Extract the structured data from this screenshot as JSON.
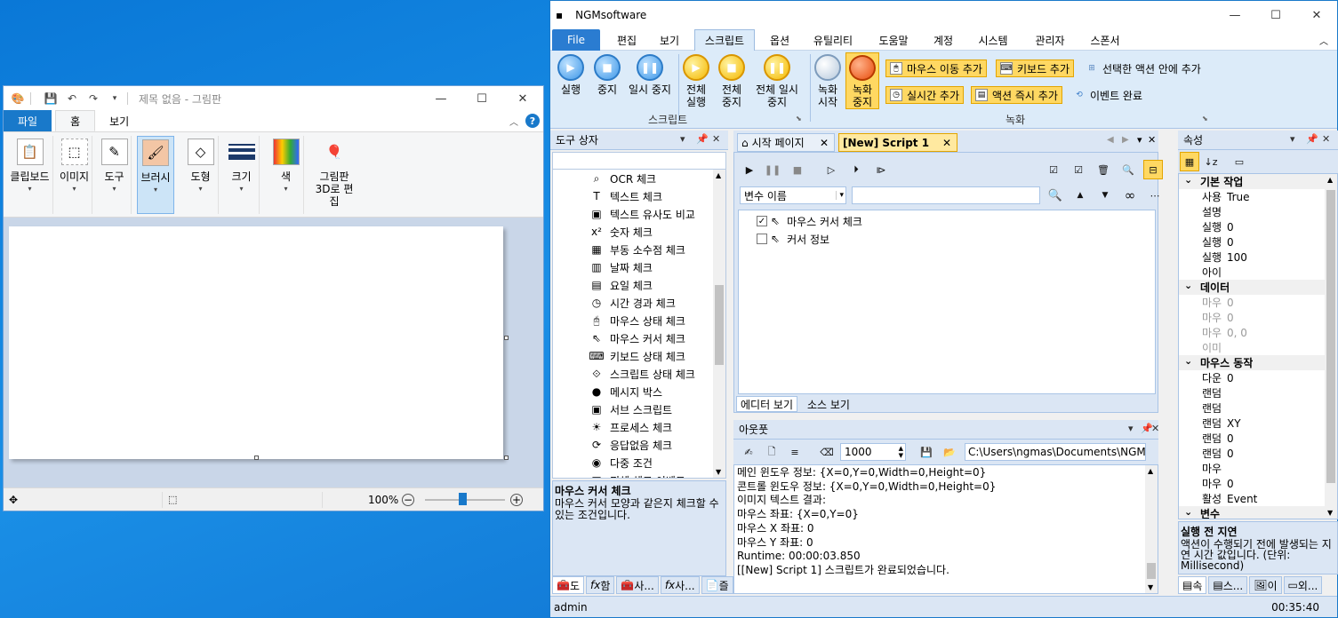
{
  "paint": {
    "title": "제목 없음 - 그림판",
    "tabs": [
      "파일",
      "홈",
      "보기"
    ],
    "groups": [
      {
        "label": "클립보드",
        "icon": "clipboard-icon"
      },
      {
        "label": "이미지",
        "icon": "image-select-icon"
      },
      {
        "label": "도구",
        "icon": "tools-icon"
      },
      {
        "label": "브러시",
        "icon": "brush-icon"
      },
      {
        "label": "도형",
        "icon": "shapes-icon"
      },
      {
        "label": "크기",
        "icon": "size-icon"
      },
      {
        "label": "색",
        "icon": "color-icon"
      },
      {
        "label": "그림판 3D로 편집",
        "icon": "paint3d-icon"
      }
    ],
    "zoom": "100%"
  },
  "ngm": {
    "title": "NGMsoftware",
    "menus": [
      "File",
      "편집",
      "보기",
      "스크립트",
      "옵션",
      "유틸리티",
      "도움말",
      "계정",
      "시스템",
      "관리자",
      "스폰서"
    ],
    "ribbon": {
      "play": "실행",
      "stop": "중지",
      "pause": "일시 중지",
      "all_play": "전체 실행",
      "all_stop": "전체 중지",
      "all_pause": "전체 일시 중지",
      "record_start": "녹화 시작",
      "record_stop": "녹화 중지",
      "add_mouse_move": "마우스 이동 추가",
      "add_keyboard": "키보드 추가",
      "add_in_selected": "선택한 액션 안에 추가",
      "add_realtime": "실시간 추가",
      "add_action_now": "액션 즉시 추가",
      "event_done": "이벤트 완료",
      "group_script": "스크립트",
      "group_record": "녹화"
    },
    "toolbox": {
      "title": "도구 상자",
      "items": [
        "OCR 체크",
        "텍스트 체크",
        "텍스트 유사도 비교",
        "숫자 체크",
        "부동 소수점 체크",
        "날짜 체크",
        "요일 체크",
        "시간 경과 체크",
        "마우스 상태 체크",
        "마우스 커서 체크",
        "키보드 상태 체크",
        "스크립트 상태 체크",
        "메시지 박스",
        "서브 스크립트",
        "프로세스 체크",
        "응답없음 체크",
        "다중 조건",
        "픽셀 체크 이벤트"
      ],
      "desc_title": "마우스 커서 체크",
      "desc_body": "마우스 커서 모양과 같은지 체크할 수 있는 조건입니다.",
      "bottom_tabs": [
        "도",
        "함",
        "사...",
        "사...",
        "즐"
      ]
    },
    "editor": {
      "tabs": [
        "시작 페이지",
        "[New] Script 1"
      ],
      "variable_placeholder": "변수 이름",
      "tree": [
        "마우스 커서 체크",
        "커서 정보"
      ],
      "view_tabs": [
        "에디터 보기",
        "소스 보기"
      ]
    },
    "output": {
      "title": "아웃풋",
      "count": "1000",
      "path": "C:\\Users\\ngmas\\Documents\\NGM6\\",
      "lines": [
        "메인 윈도우 정보: {X=0,Y=0,Width=0,Height=0}",
        "콘트롤 윈도우 정보: {X=0,Y=0,Width=0,Height=0}",
        "이미지 텍스트 결과:",
        "마우스 좌표: {X=0,Y=0}",
        "마우스 X 좌표: 0",
        "마우스 Y 좌표: 0",
        "Runtime: 00:00:03.850",
        "[[New] Script 1] 스크립트가 완료되었습니다."
      ]
    },
    "properties": {
      "title": "속성",
      "rows": [
        {
          "cat": "기본 작업"
        },
        {
          "k": "사용 여부",
          "v": "True"
        },
        {
          "k": "설명",
          "v": ""
        },
        {
          "k": "실행 전",
          "v": "0"
        },
        {
          "k": "실행 후",
          "v": "0"
        },
        {
          "k": "실행율",
          "v": "100"
        },
        {
          "k": "아이디",
          "v": ""
        },
        {
          "cat": "데이터"
        },
        {
          "k": "마우스 X",
          "v": "0",
          "dis": true
        },
        {
          "k": "마우스 Y",
          "v": "0",
          "dis": true
        },
        {
          "k": "마우스 좌",
          "v": "0, 0",
          "dis": true
        },
        {
          "k": "이미지 텍",
          "v": "",
          "dis": true
        },
        {
          "cat": "마우스 동작"
        },
        {
          "k": "다운 업",
          "v": "0"
        },
        {
          "k": "랜덤 맥스",
          "v": ""
        },
        {
          "k": "랜덤 미니",
          "v": ""
        },
        {
          "k": "랜덤 적용",
          "v": "XY"
        },
        {
          "k": "랜덤 지연",
          "v": "0"
        },
        {
          "k": "랜덤 지연",
          "v": "0"
        },
        {
          "k": "마우스 클",
          "v": ""
        },
        {
          "k": "마우스 슬",
          "v": "0"
        },
        {
          "k": "활성 모드",
          "v": "Event"
        },
        {
          "cat": "변수"
        }
      ],
      "desc_title": "실행 전 지연",
      "desc_body": "액션이 수행되기 전에 발생되는 지연 시간 값입니다. (단위: Millisecond)",
      "bottom_tabs": [
        "속",
        "스...",
        "이",
        "외..."
      ]
    },
    "status": {
      "user": "admin",
      "time": "00:35:40"
    }
  }
}
